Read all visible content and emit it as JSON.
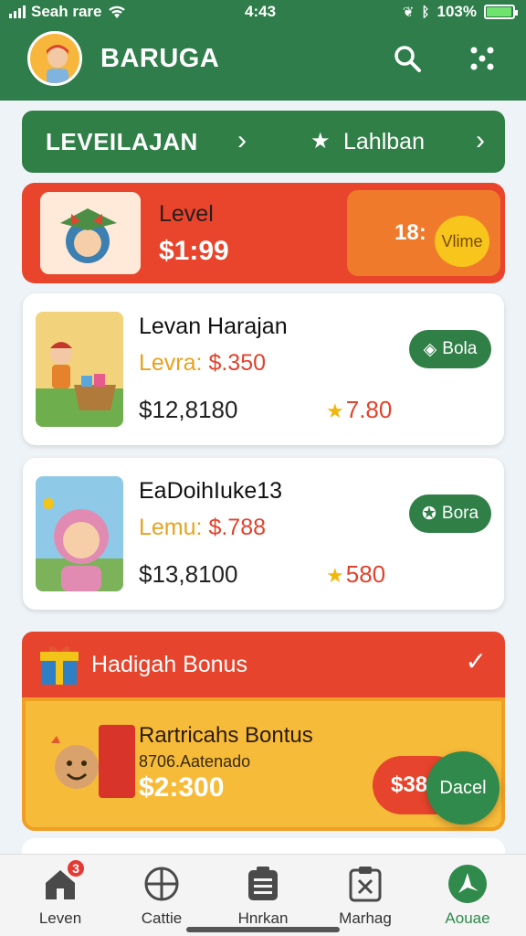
{
  "status": {
    "carrier": "Seah rare",
    "time": "4:43",
    "battery": "103%"
  },
  "header": {
    "title": "BARUGA"
  },
  "banner": {
    "left_label": "LEVEILAJAN",
    "right_label": "Lahlban"
  },
  "level_card": {
    "label": "Level",
    "price": "$1:99",
    "side_value": "18:",
    "pill_label": "Vlime"
  },
  "products": [
    {
      "title": "Levan Harajan",
      "sub_key": "Levra:",
      "sub_value": "$.350",
      "stat": "$12,8180",
      "rating": "7.80",
      "tag": "Bola"
    },
    {
      "title": "EaDoihIuke13",
      "sub_key": "Lemu:",
      "sub_value": "$.788",
      "stat": "$13,8100",
      "rating": "580",
      "tag": "Bora"
    }
  ],
  "bonus": {
    "header": "Hadigah Bonus",
    "title": "Rartricahs Bontus",
    "subtitle": "8706.Aatenado",
    "amount": "$2:300",
    "cta": "$38",
    "fab_label": "Dacel"
  },
  "nav": [
    {
      "label": "Leven",
      "icon": "home-icon",
      "badge": "3"
    },
    {
      "label": "Cattie",
      "icon": "globe-icon"
    },
    {
      "label": "Hnrkan",
      "icon": "clipboard-list-icon"
    },
    {
      "label": "Marhag",
      "icon": "clipboard-x-icon"
    },
    {
      "label": "Aouae",
      "icon": "compass-icon"
    }
  ],
  "colors": {
    "brand_green": "#2e7d4a",
    "accent_red": "#e6442c",
    "accent_orange": "#f07a2c",
    "accent_yellow": "#f7bb3a"
  }
}
